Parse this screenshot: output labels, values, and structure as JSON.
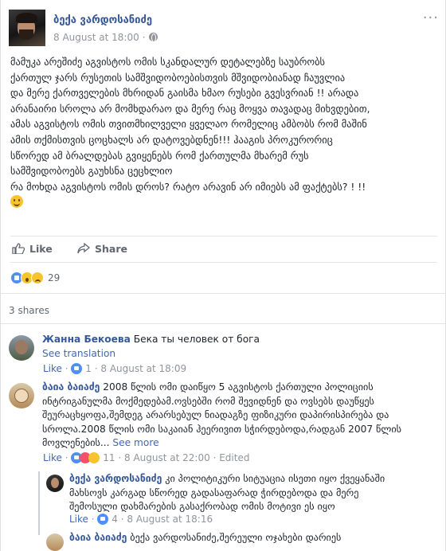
{
  "post": {
    "author": "ბექა ვარდოსანიძე",
    "date": "8 August at 18:00",
    "separator": "·",
    "more_label": "···",
    "text_lines": [
      "მამუკა არეშიძე აგვისტოს ომის სკანდალურ დეტალებზე საუბრობს",
      "ქართულ ჯარს რუსეთის სამშვიდობოებისთვის მშვიდობიანად ჩაუვლია",
      "და მერე ქართველების მხრიდან გაისმა ხმაო რუსები გვესვრიან !! არადა",
      "არანაირი სროლა არ მომხდარაო და მერე რაც მოყვა თავადაც მიხვდებით,",
      "ამას აგვისტოს ომის თვითმხილველი ყველაო რომელიც ამბობს რომ მაშინ",
      "ამის თქმისთვის ცოცხალს არ დატოვებდნენ!!! ჰააგის პროკურორიც",
      "სწორედ ამ ბრალდებას გვიყენებს რომ ქართულმა მხარემ რუს",
      "სამშვიდობოებს გაუხსნა ცეცხლიო",
      "რა მოხდა აგვისტოს ომის დროს? რატო არავინ არ იმიებს ამ ფაქტებს? ! !!"
    ],
    "emoji_icon": "slightly-smiling-face-icon"
  },
  "actions": {
    "like_label": "Like",
    "share_label": "Share"
  },
  "reactions": {
    "icons": [
      "like-icon",
      "wow-icon",
      "sad-icon"
    ],
    "count": "29"
  },
  "shares_label": "3 shares",
  "comments": [
    {
      "name": "Жанна Бекоева",
      "text": "Бека ты человек от бога",
      "see_translation": "See translation",
      "like_label": "Like",
      "dot": "·",
      "reaction_count": "1",
      "time": "8 August at 18:09"
    },
    {
      "name": "ბაია ბაიაძე",
      "text_lines": [
        "2008 წლის ომი დაიწყო 5 აგვისტოს ქართული პოლიციის",
        "ინტრიგანულმა მოქმედებამ.ოვსებში რომ შევიდნენ და ოვსებს დაუწყეს",
        "შეურაცხყოფა,შემდეგ არარსებულ ნიადაგზე ფიზიკური დაპირისპირება და",
        "სროლა.2008 წლის ომი საკაიან ჰეერივით სჭირდებოდა,რადგან 2007 წლის",
        "მოვლენების..."
      ],
      "see_more": "See more",
      "like_label": "Like",
      "dot": "·",
      "reaction_count": "11",
      "time": "8 August at 22:00",
      "edited": "Edited"
    },
    {
      "name": "ბექა ვარდოსანიძე",
      "text_lines": [
        "კი პოლიტიკური სიტუაცია ისეთი იყო ქვეყანაში",
        "მახსოვს კარგად სწორედ გადასაფარად ჭირდებოდა და მერე",
        "შემოსული დახმარების გასაქრობად ომის მოტივი ეს იყო"
      ],
      "like_label": "Like",
      "dot": "·",
      "reaction_count": "4",
      "time": "8 August at 18:16"
    },
    {
      "name": "ბაია ბაიაძე",
      "text": "ბექა ვარდოსანიძე,შერეული ოჯახები დარიეს"
    }
  ]
}
